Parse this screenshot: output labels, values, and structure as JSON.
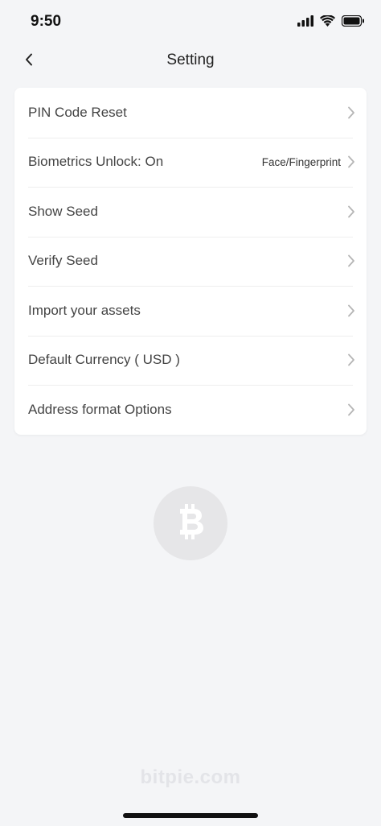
{
  "status_bar": {
    "time": "9:50",
    "icons": [
      "signal-icon",
      "wifi-icon",
      "battery-icon"
    ]
  },
  "nav": {
    "title": "Setting",
    "back_icon": "chevron-left-icon"
  },
  "settings": [
    {
      "label": "PIN Code Reset",
      "value": ""
    },
    {
      "label": "Biometrics Unlock: On",
      "value": "Face/Fingerprint"
    },
    {
      "label": "Show Seed",
      "value": ""
    },
    {
      "label": "Verify Seed",
      "value": ""
    },
    {
      "label": "Import your assets",
      "value": ""
    },
    {
      "label": "Default Currency ( USD )",
      "value": ""
    },
    {
      "label": "Address format Options",
      "value": ""
    }
  ],
  "logo": {
    "icon": "bitcoin-icon"
  },
  "watermark": "bitpie.com",
  "colors": {
    "background": "#f4f5f7",
    "card": "#ffffff",
    "chevron": "#b5b5b5",
    "logo_bg": "#e6e6e8",
    "watermark": "#e3e4e8"
  }
}
